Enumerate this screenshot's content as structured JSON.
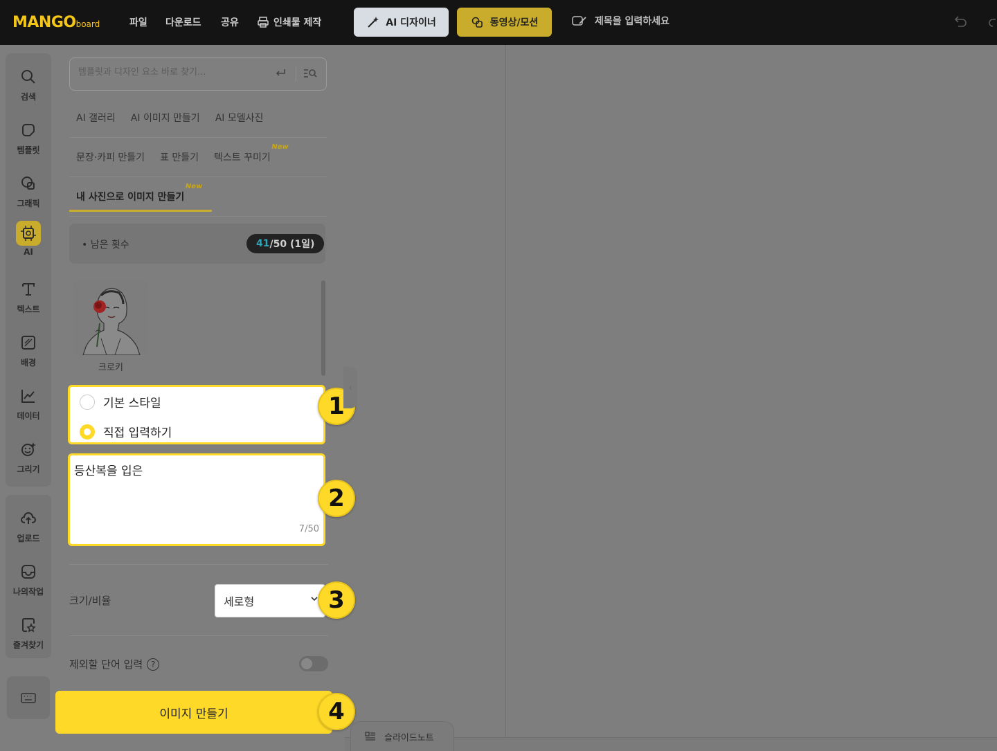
{
  "app": {
    "logo_main": "MANGO",
    "logo_sub": "board"
  },
  "topbar": {
    "menu_file": "파일",
    "menu_download": "다운로드",
    "menu_share": "공유",
    "menu_print": "인쇄물 제작",
    "ai_designer": "AI 디자이너",
    "video_motion": "동영상/모션",
    "title_placeholder": "제목을 입력하세요"
  },
  "rail": {
    "items": [
      {
        "label": "검색",
        "icon": "search-icon"
      },
      {
        "label": "템플릿",
        "icon": "template-icon"
      },
      {
        "label": "그래픽",
        "icon": "graphic-icon"
      },
      {
        "label": "AI",
        "icon": "ai-chip-icon"
      },
      {
        "label": "텍스트",
        "icon": "text-icon"
      },
      {
        "label": "배경",
        "icon": "background-icon"
      },
      {
        "label": "데이터",
        "icon": "chart-icon"
      },
      {
        "label": "그리기",
        "icon": "draw-icon"
      }
    ],
    "items2": [
      {
        "label": "업로드",
        "icon": "upload-icon"
      },
      {
        "label": "나의작업",
        "icon": "my-work-icon"
      },
      {
        "label": "즐겨찾기",
        "icon": "favorite-icon"
      }
    ]
  },
  "panel": {
    "search_placeholder": "템플릿과 디자인 요소 바로 찾기...",
    "tabs_row1": [
      "AI 갤러리",
      "AI 이미지 만들기",
      "AI 모델사진"
    ],
    "tabs_row2": [
      "문장·카피 만들기",
      "표 만들기",
      "텍스트 꾸미기"
    ],
    "tabs_row3": [
      "내 사진으로 이미지 만들기"
    ],
    "new_badge": "New",
    "remain_label": "남은 횟수",
    "remain_used": "41",
    "remain_total": "/50 (1일)",
    "style_thumb_caption": "크로키",
    "style_option_basic": "기본 스타일",
    "style_option_custom": "직접 입력하기",
    "prompt_value": "등산복을 입은",
    "prompt_count": "7/50",
    "size_label": "크기/비율",
    "size_value": "세로형",
    "exclude_label": "제외할 단어 입력",
    "help_symbol": "?",
    "make_button": "이미지 만들기"
  },
  "badges": [
    "1",
    "2",
    "3",
    "4"
  ],
  "canvas": {
    "slidenote": "슬라이드노트"
  },
  "colors": {
    "accent": "#ffd928",
    "topbar": "#141414",
    "overlay": "#7e7e7e"
  }
}
